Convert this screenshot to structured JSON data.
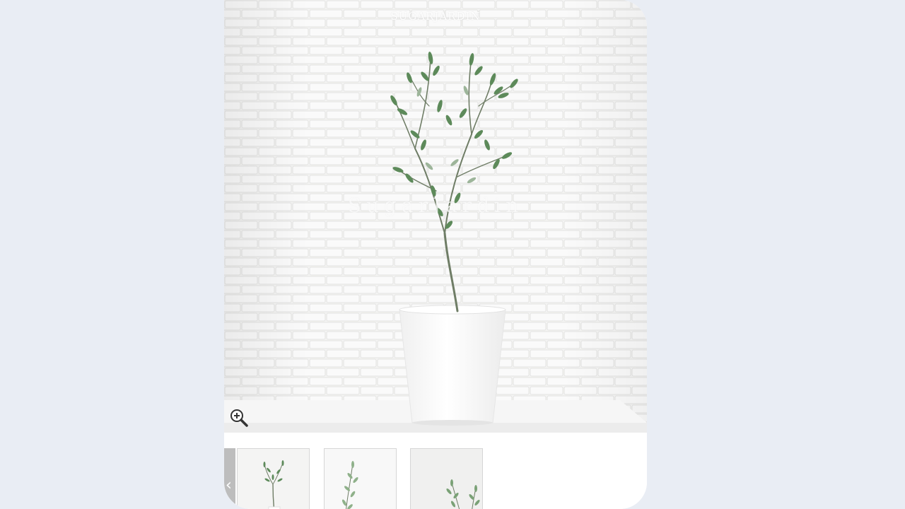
{
  "app": {
    "brand": "SUGARJARDIN",
    "watermark": "SugarJardin"
  },
  "gallery": {
    "zoom_icon": "zoom-in-icon",
    "prev_icon": "chevron-left-icon",
    "prev_glyph": "‹",
    "thumbnails": [
      {
        "icon": "olive-tree-thumbnail",
        "selected": true
      },
      {
        "icon": "olive-branch-thumbnail",
        "selected": false
      },
      {
        "icon": "olive-branch-thumbnail-2",
        "selected": false
      }
    ]
  },
  "colors": {
    "background": "#e9edf4",
    "wall": "#f3f3f2",
    "leaf": "#5d8a5a",
    "stem": "#6f7d66",
    "pot": "#ffffff"
  }
}
